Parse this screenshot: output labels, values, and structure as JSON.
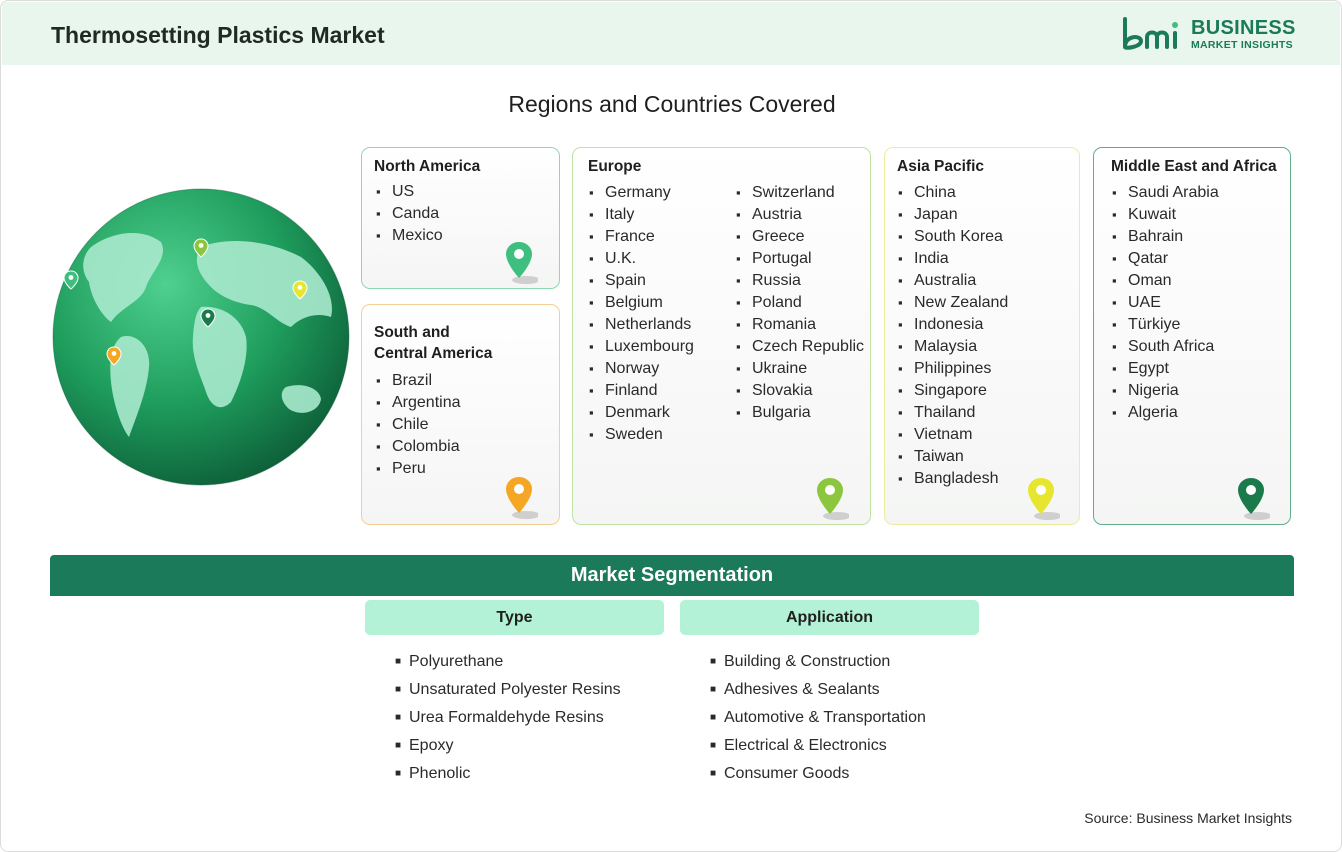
{
  "header": {
    "title": "Thermosetting Plastics Market"
  },
  "logo": {
    "line1": "BUSINESS",
    "line2": "MARKET INSIGHTS",
    "mark": "bmi"
  },
  "colors": {
    "brand": "#1b7a5a",
    "light_green": "#b3f2d6",
    "header_bg": "#e9f6ee"
  },
  "regions_title": "Regions and Countries Covered",
  "regions": {
    "north_america": {
      "name": "North America",
      "pin_color": "#3fbf7f",
      "border": "#8fd9b0",
      "countries": [
        "US",
        "Canda",
        "Mexico"
      ]
    },
    "south_america": {
      "name_line1": "South and",
      "name_line2": "Central America",
      "pin_color": "#f5a623",
      "border": "#f3cf95",
      "countries": [
        "Brazil",
        "Argentina",
        "Chile",
        "Colombia",
        "Peru"
      ]
    },
    "europe": {
      "name": "Europe",
      "pin_color": "#8cc63f",
      "border": "#bfe3a0",
      "countries_col1": [
        "Germany",
        "Italy",
        "France",
        "U.K.",
        "Spain",
        "Belgium",
        "Netherlands",
        "Luxembourg",
        "Norway",
        "Finland",
        "Denmark",
        "Sweden"
      ],
      "countries_col2": [
        "Switzerland",
        "Austria",
        "Greece",
        "Portugal",
        "Russia",
        "Poland",
        "Romania",
        "Czech Republic",
        "Ukraine",
        "Slovakia",
        "Bulgaria"
      ]
    },
    "asia_pacific": {
      "name": "Asia Pacific",
      "pin_color": "#e6e62e",
      "border": "#ecec9e",
      "countries": [
        "China",
        "Japan",
        "South Korea",
        "India",
        "Australia",
        "New Zealand",
        "Indonesia",
        "Malaysia",
        "Philippines",
        "Singapore",
        "Thailand",
        "Vietnam",
        "Taiwan",
        "Bangladesh"
      ]
    },
    "mea": {
      "name": "Middle East and Africa",
      "pin_color": "#1b7a4a",
      "border": "#5fb08a",
      "countries": [
        "Saudi Arabia",
        "Kuwait",
        "Bahrain",
        "Qatar",
        "Oman",
        "UAE",
        "Türkiye",
        "South Africa",
        "Egypt",
        "Nigeria",
        "Algeria"
      ]
    }
  },
  "segmentation": {
    "title": "Market Segmentation",
    "type": {
      "label": "Type",
      "items": [
        "Polyurethane",
        "Unsaturated Polyester Resins",
        "Urea Formaldehyde Resins",
        "Epoxy",
        "Phenolic"
      ]
    },
    "application": {
      "label": "Application",
      "items": [
        "Building & Construction",
        "Adhesives & Sealants",
        "Automotive & Transportation",
        "Electrical & Electronics",
        "Consumer Goods"
      ]
    }
  },
  "source": "Source: Business Market Insights"
}
